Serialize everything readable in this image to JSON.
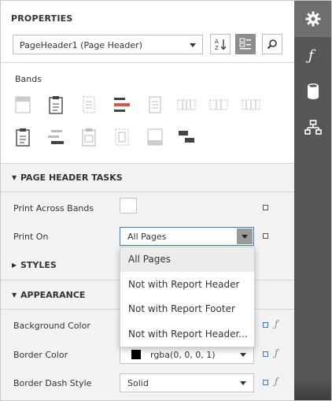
{
  "panel": {
    "title": "PROPERTIES",
    "component_selector": {
      "value": "PageHeader1 (Page Header)"
    },
    "sort_button_icon": "sort-alpha-icon",
    "categories_button_icon": "categorized-view-icon",
    "search_button_icon": "search-icon"
  },
  "bands": {
    "label": "Bands",
    "icons_row1": [
      "report-header-band",
      "page-header-band",
      "group-header-band",
      "detail-band",
      "group-footer-band",
      "detail-report-band",
      "vertical-header-band",
      "vertical-details-band"
    ],
    "icons_row2": [
      "page-footer-band",
      "group-footer-bar-band",
      "report-footer-band",
      "sub-band",
      "bottom-margin-band",
      "top-margin-band"
    ]
  },
  "page_header_tasks": {
    "header": "PAGE HEADER TASKS",
    "print_across_bands": {
      "label": "Print Across Bands",
      "checked": false
    },
    "print_on": {
      "label": "Print On",
      "value": "All Pages"
    }
  },
  "styles": {
    "header": "STYLES"
  },
  "appearance": {
    "header": "APPEARANCE",
    "background_color": {
      "label": "Background Color"
    },
    "border_color": {
      "label": "Border Color",
      "value": "rgba(0, 0, 0, 1)",
      "swatch": "#000000"
    },
    "border_dash_style": {
      "label": "Border Dash Style",
      "value": "Solid"
    }
  },
  "dropdown": {
    "options": [
      "All Pages",
      "Not with Report Header",
      "Not with Report Footer",
      "Not with Report Header..."
    ],
    "selected_index": 0
  },
  "rail": {
    "items": [
      "gear-icon",
      "function-icon",
      "database-icon",
      "report-explorer-icon"
    ],
    "active_index": 0
  },
  "colors": {
    "rail_bg": "#565656",
    "accent": "#3b7fb8",
    "section_bg": "#f3f3f3"
  }
}
